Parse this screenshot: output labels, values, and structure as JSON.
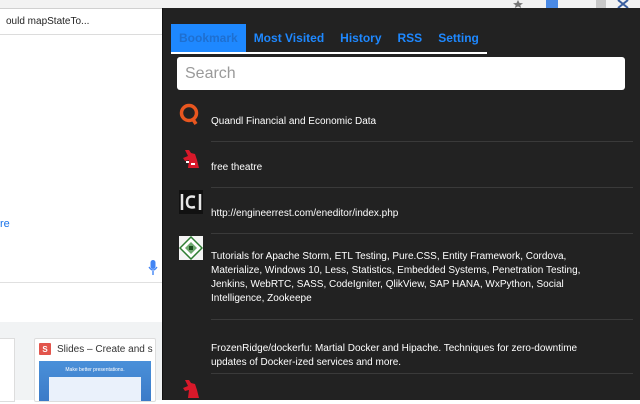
{
  "background": {
    "tab_title": "ould mapStateTo...",
    "link_fragment": "re",
    "thumbnail_title": "Slides – Create and s",
    "thumbnail_icon_letter": "S",
    "thumbnail_preview_text": "Make better presentations."
  },
  "popup": {
    "tabs": [
      {
        "label": "Bookmark",
        "active": true
      },
      {
        "label": "Most Visited",
        "active": false
      },
      {
        "label": "History",
        "active": false
      },
      {
        "label": "RSS",
        "active": false
      },
      {
        "label": "Setting",
        "active": false
      }
    ],
    "search": {
      "placeholder": "Search",
      "value": ""
    },
    "bookmarks": [
      {
        "title": "Quandl Financial and Economic Data",
        "icon": "quandl-q-icon"
      },
      {
        "title": "free theatre",
        "icon": "red-unicorn-icon"
      },
      {
        "title": "http://engineerrest.com/eneditor/index.php",
        "icon": "ici-logo-icon"
      },
      {
        "title": "Tutorials for Apache Storm, ETL Testing, Pure.CSS, Entity Framework, Cordova, Materialize, Windows 10, Less, Statistics, Embedded Systems, Penetration Testing, Jenkins, WebRTC, SASS, CodeIgniter, QlikView, SAP HANA, WxPython, Social Intelligence, Zookeepe",
        "icon": "tutorials-diamond-icon"
      },
      {
        "title": "FrozenRidge/dockerfu: Martial Docker and Hipache. Techniques for zero-downtime updates of Docker-ized services and more.",
        "icon": "none"
      },
      {
        "title": "",
        "icon": "red-unicorn-icon"
      }
    ]
  },
  "colors": {
    "popup_bg": "#222222",
    "tab_accent": "#1e88ff",
    "quandl_orange": "#e8561f",
    "unicorn_red": "#d8192a"
  }
}
